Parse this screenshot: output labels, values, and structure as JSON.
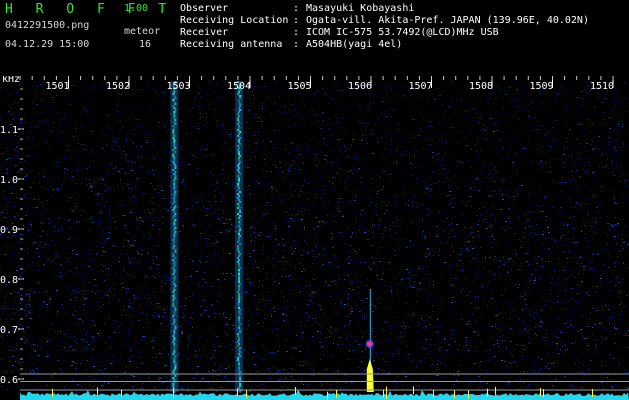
{
  "app": {
    "name": "H R O F F T",
    "version": "1.00",
    "filename": "0412291500.png",
    "datetime": "04.12.29 15:00",
    "count_label": "meteor",
    "count_value": "16"
  },
  "station": {
    "rows": [
      {
        "label": "Observer",
        "value": "Masayuki Kobayashi"
      },
      {
        "label": "Receiving Location",
        "value": "Ogata-vill. Akita-Pref. JAPAN (139.96E, 40.02N)"
      },
      {
        "label": "Receiver",
        "value": "ICOM IC-575 53.7492(@LCD)MHz USB"
      },
      {
        "label": "Receiving antenna",
        "value": "A504HB(yagi 4el)"
      }
    ]
  },
  "spectrogram": {
    "freq_unit": "kHz",
    "freq_ticks": [
      1.1,
      1.0,
      0.9,
      0.8,
      0.7,
      0.6
    ],
    "freq_tick_labels": [
      "1.1",
      "1.0",
      "0.9",
      "0.8",
      "0.7",
      "0.6"
    ],
    "freq_range": [
      0.57,
      1.2
    ],
    "time_labels": [
      "1501",
      "1502",
      "1503",
      "1504",
      "1505",
      "1506",
      "1507",
      "1508",
      "1509",
      "1510"
    ],
    "time_range": [
      1500.0,
      1510.2
    ],
    "vertical_streaks_time": [
      1502.75,
      1503.82
    ],
    "meteor_echo": {
      "time": 1505.98,
      "freq_center": 0.67
    },
    "colors": {
      "background": "#000000",
      "noise_low": "#0a1a8c",
      "noise_high": "#1e6cff",
      "streak": "#2fe0c0",
      "meteor": "#ffff33",
      "meteor_core": "#ff4060",
      "label": "#ffffff"
    }
  }
}
